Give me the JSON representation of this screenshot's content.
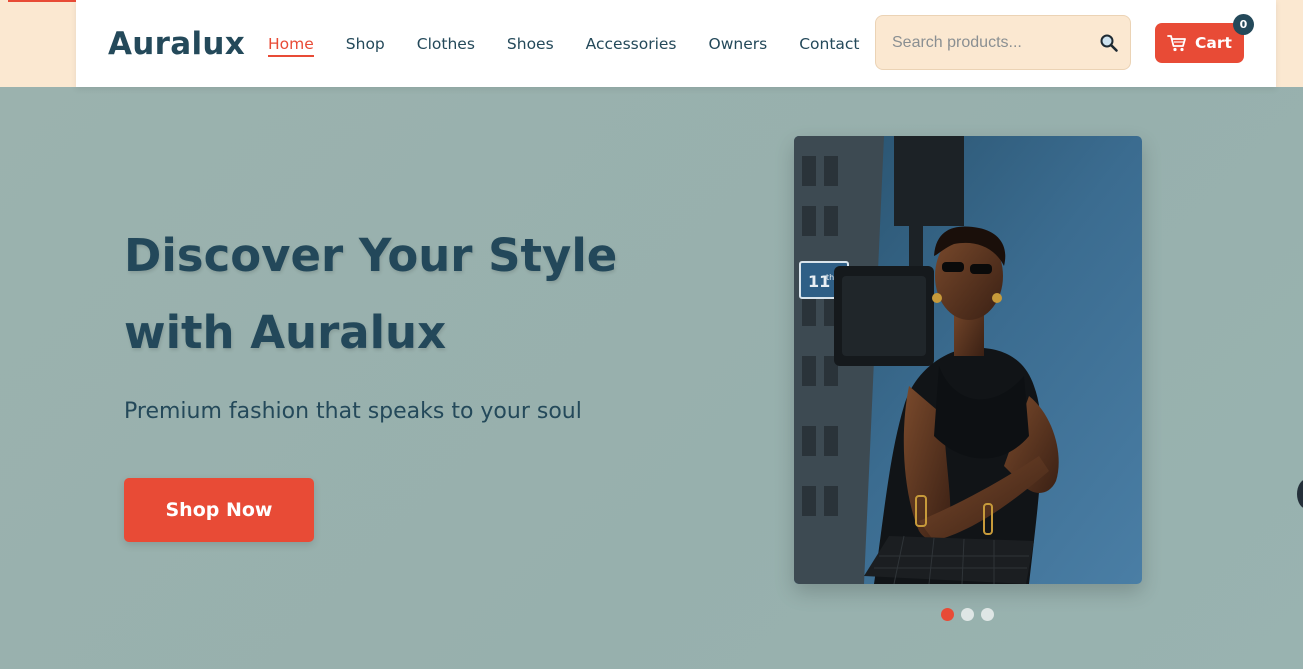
{
  "brand": {
    "logo": "Auralux"
  },
  "nav": {
    "items": [
      {
        "label": "Home",
        "active": true
      },
      {
        "label": "Shop",
        "active": false
      },
      {
        "label": "Clothes",
        "active": false
      },
      {
        "label": "Shoes",
        "active": false
      },
      {
        "label": "Accessories",
        "active": false
      },
      {
        "label": "Owners",
        "active": false
      },
      {
        "label": "Contact",
        "active": false
      }
    ]
  },
  "search": {
    "placeholder": "Search products...",
    "value": "",
    "icon": "search-icon"
  },
  "cart": {
    "label": "Cart",
    "count": "0",
    "icon": "cart-icon"
  },
  "hero": {
    "title_line1": "Discover Your Style",
    "title_line2": "with Auralux",
    "subtitle": "Premium fashion that speaks to your soul",
    "cta_label": "Shop Now",
    "slides": 3,
    "active_slide": 1
  },
  "colors": {
    "accent": "#e84b36",
    "primary_text": "#24495a",
    "hero_bg": "#99b2af",
    "page_bg": "#fbe8d1"
  }
}
